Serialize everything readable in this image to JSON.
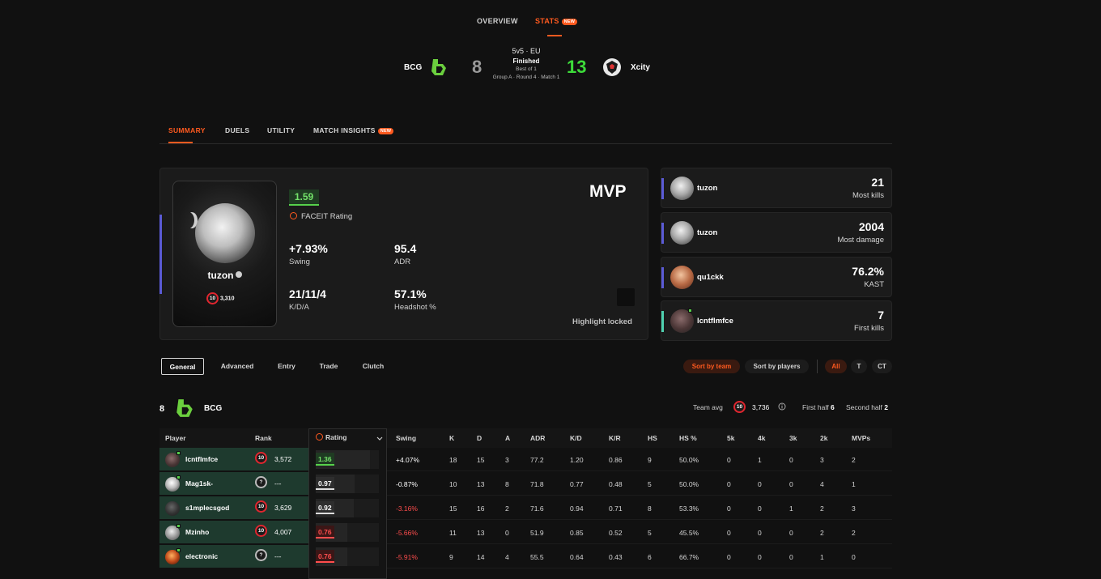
{
  "topnav": {
    "overview": "OVERVIEW",
    "stats": "STATS",
    "new_badge": "NEW"
  },
  "match": {
    "team1": {
      "name": "BCG",
      "score": "8"
    },
    "team2": {
      "name": "Xcity",
      "score": "13"
    },
    "mode": "5v5 · EU",
    "status": "Finished",
    "format": "Best of 1",
    "stage": "Group A · Round 4 · Match 1"
  },
  "section_tabs": {
    "summary": "SUMMARY",
    "duels": "DUELS",
    "utility": "UTILITY",
    "match_insights": "MATCH INSIGHTS",
    "new_badge": "NEW"
  },
  "mvp": {
    "title": "MVP",
    "player": "tuzon",
    "level": "10",
    "elo": "3,310",
    "rating": "1.59",
    "rating_label": "FACEIT Rating",
    "swing": "+7.93%",
    "swing_label": "Swing",
    "adr": "95.4",
    "adr_label": "ADR",
    "kda": "21/11/4",
    "kda_label": "K/D/A",
    "hs": "57.1%",
    "hs_label": "Headshot %",
    "highlight": "Highlight locked"
  },
  "awards": [
    {
      "name": "tuzon",
      "value": "21",
      "label": "Most kills",
      "color": "#5b5bd6"
    },
    {
      "name": "tuzon",
      "value": "2004",
      "label": "Most damage",
      "color": "#5b5bd6"
    },
    {
      "name": "qu1ckk",
      "value": "76.2%",
      "label": "KAST",
      "color": "#5b5bd6"
    },
    {
      "name": "lcntflmfce",
      "value": "7",
      "label": "First kills",
      "color": "#4fd1b0"
    }
  ],
  "filters": {
    "tabs": [
      "General",
      "Advanced",
      "Entry",
      "Trade",
      "Clutch"
    ],
    "sort_team": "Sort by team",
    "sort_players": "Sort by players",
    "side_all": "All",
    "side_t": "T",
    "side_ct": "CT"
  },
  "team_summary": {
    "score": "8",
    "name": "BCG",
    "avg_label": "Team avg",
    "avg_level": "10",
    "avg_elo": "3,736",
    "first_half_label": "First half",
    "first_half": "6",
    "second_half_label": "Second half",
    "second_half": "2"
  },
  "table": {
    "headers": {
      "player": "Player",
      "rank": "Rank",
      "rating": "Rating",
      "swing": "Swing",
      "k": "K",
      "d": "D",
      "a": "A",
      "adr": "ADR",
      "kd": "K/D",
      "kr": "K/R",
      "hs": "HS",
      "hsp": "HS %",
      "k5": "5k",
      "k4": "4k",
      "k3": "3k",
      "k2": "2k",
      "mvps": "MVPs"
    },
    "rows": [
      {
        "player": "lcntflmfce",
        "level": "10",
        "elo": "3,572",
        "rating": "1.36",
        "rating_pct": 0.86,
        "swing": "+4.07%",
        "k": "18",
        "d": "15",
        "a": "3",
        "adr": "77.2",
        "kd": "1.20",
        "kr": "0.86",
        "hs": "9",
        "hsp": "50.0%",
        "k5": "0",
        "k4": "1",
        "k3": "0",
        "k2": "3",
        "mvps": "2"
      },
      {
        "player": "Mag1sk-",
        "level": "?",
        "elo": "---",
        "rating": "0.97",
        "rating_pct": 0.62,
        "swing": "-0.87%",
        "k": "10",
        "d": "13",
        "a": "8",
        "adr": "71.8",
        "kd": "0.77",
        "kr": "0.48",
        "hs": "5",
        "hsp": "50.0%",
        "k5": "0",
        "k4": "0",
        "k3": "0",
        "k2": "4",
        "mvps": "1"
      },
      {
        "player": "s1mplecsgod",
        "level": "10",
        "elo": "3,629",
        "rating": "0.92",
        "rating_pct": 0.6,
        "swing": "-3.16%",
        "k": "15",
        "d": "16",
        "a": "2",
        "adr": "71.6",
        "kd": "0.94",
        "kr": "0.71",
        "hs": "8",
        "hsp": "53.3%",
        "k5": "0",
        "k4": "0",
        "k3": "1",
        "k2": "2",
        "mvps": "3"
      },
      {
        "player": "Mzinho",
        "level": "10",
        "elo": "4,007",
        "rating": "0.76",
        "rating_pct": 0.5,
        "swing": "-5.66%",
        "k": "11",
        "d": "13",
        "a": "0",
        "adr": "51.9",
        "kd": "0.85",
        "kr": "0.52",
        "hs": "5",
        "hsp": "45.5%",
        "k5": "0",
        "k4": "0",
        "k3": "0",
        "k2": "2",
        "mvps": "2"
      },
      {
        "player": "electronic",
        "level": "?",
        "elo": "---",
        "rating": "0.76",
        "rating_pct": 0.5,
        "swing": "-5.91%",
        "k": "9",
        "d": "14",
        "a": "4",
        "adr": "55.5",
        "kd": "0.64",
        "kr": "0.43",
        "hs": "6",
        "hsp": "66.7%",
        "k5": "0",
        "k4": "0",
        "k3": "0",
        "k2": "1",
        "mvps": "0"
      }
    ]
  }
}
